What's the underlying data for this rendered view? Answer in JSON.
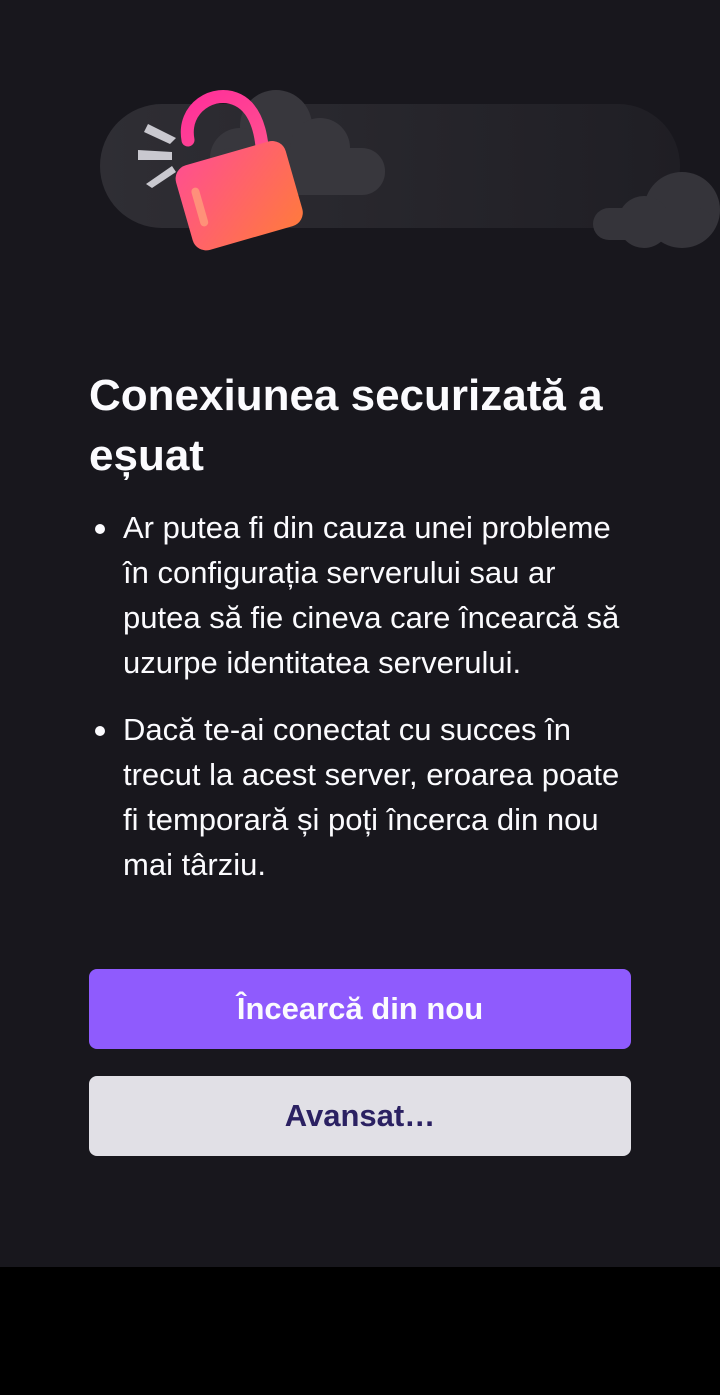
{
  "error_page": {
    "illustration_icon": "broken-lock-icon",
    "title": "Conexiunea securizată a eșuat",
    "reasons": [
      "Ar putea fi din cauza unei probleme în configurația serverului sau ar putea să fie cineva care încearcă să uzurpe identitatea serverului.",
      "Dacă te-ai conectat cu succes în trecut la acest server, eroarea poate fi temporară și poți încerca din nou mai târziu."
    ],
    "try_again_label": "Încearcă din nou",
    "advanced_label": "Avansat…"
  },
  "colors": {
    "background": "#18171d",
    "primary_button": "#8f5bfd",
    "secondary_button": "#e1e0e6",
    "secondary_button_text": "#2b2162",
    "text": "#fbfbfe",
    "lock_gradient_start": "#ff4f8f",
    "lock_gradient_end": "#ff7a3d"
  }
}
